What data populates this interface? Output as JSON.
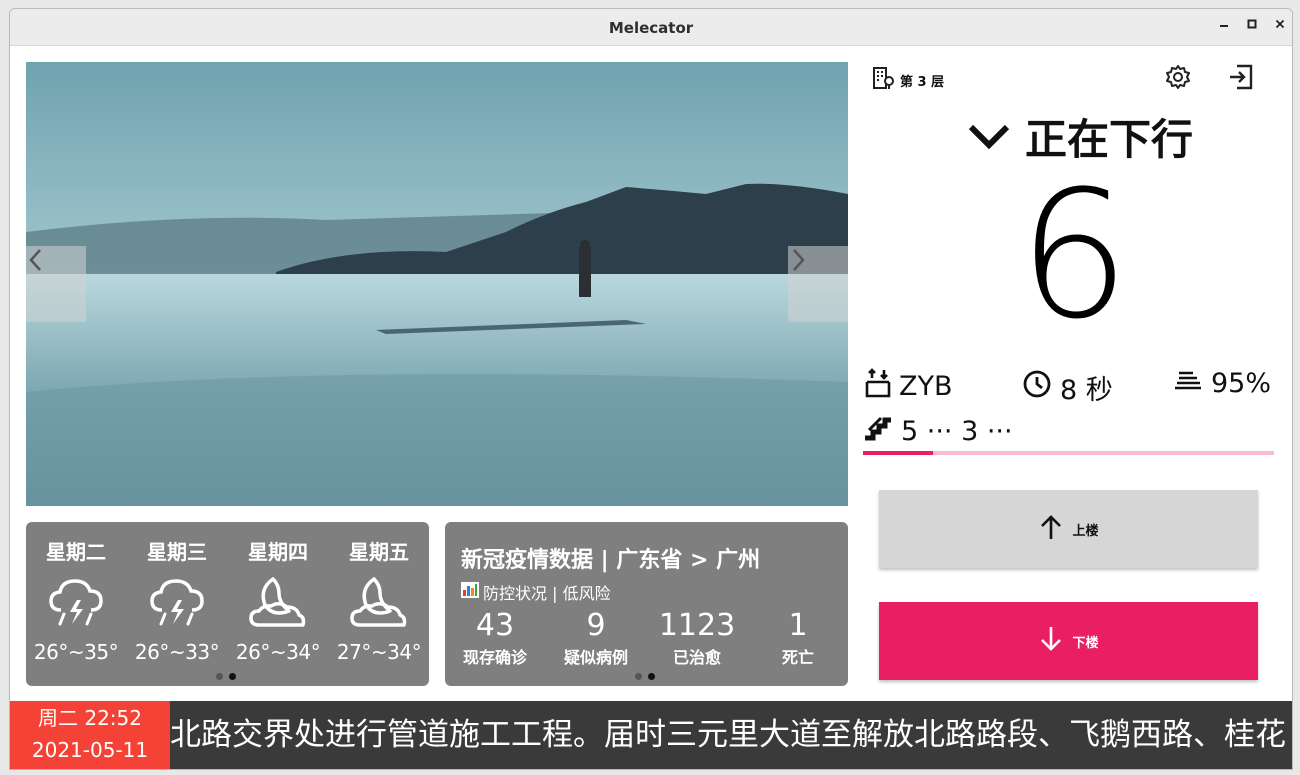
{
  "window": {
    "title": "Melecator",
    "min_icon": "minimize-icon",
    "max_icon": "maximize-icon",
    "close_icon": "close-icon"
  },
  "carousel": {
    "prev_icon": "chevron-left-icon",
    "next_icon": "chevron-right-icon"
  },
  "weather": {
    "days": [
      {
        "name": "星期二",
        "icon": "thunderstorm-icon",
        "temp": "26°~35°"
      },
      {
        "name": "星期三",
        "icon": "thunderstorm-icon",
        "temp": "26°~33°"
      },
      {
        "name": "星期四",
        "icon": "moon-cloud-icon",
        "temp": "26°~34°"
      },
      {
        "name": "星期五",
        "icon": "moon-cloud-icon",
        "temp": "27°~34°"
      }
    ]
  },
  "covid": {
    "title": "新冠疫情数据 | 广东省 > 广州",
    "status": "防控状况 | 低风险",
    "stats": [
      {
        "value": "43",
        "label": "现存确诊"
      },
      {
        "value": "9",
        "label": "疑似病例"
      },
      {
        "value": "1123",
        "label": "已治愈"
      },
      {
        "value": "1",
        "label": "死亡"
      }
    ]
  },
  "elevator": {
    "floor_label": "第 3 层",
    "direction_text": "正在下行",
    "current_floor": "6",
    "car_id": "ZYB",
    "eta": "8 秒",
    "load": "95%",
    "queue": "5 ··· 3 ···",
    "progress": 0.17,
    "up_label": "上楼",
    "down_label": "下楼"
  },
  "footer": {
    "time": "周二 22:52",
    "date": "2021-05-11",
    "ticker": "北路交界处进行管道施工工程。届时三元里大道至解放北路路段、飞鹅西路、桂花"
  },
  "colors": {
    "accent": "#e91e63",
    "accent_light": "#f8bbd0",
    "clock_bg": "#f44336",
    "card_bg": "#7f7f7f",
    "footer_bg": "#3a3a3a"
  }
}
